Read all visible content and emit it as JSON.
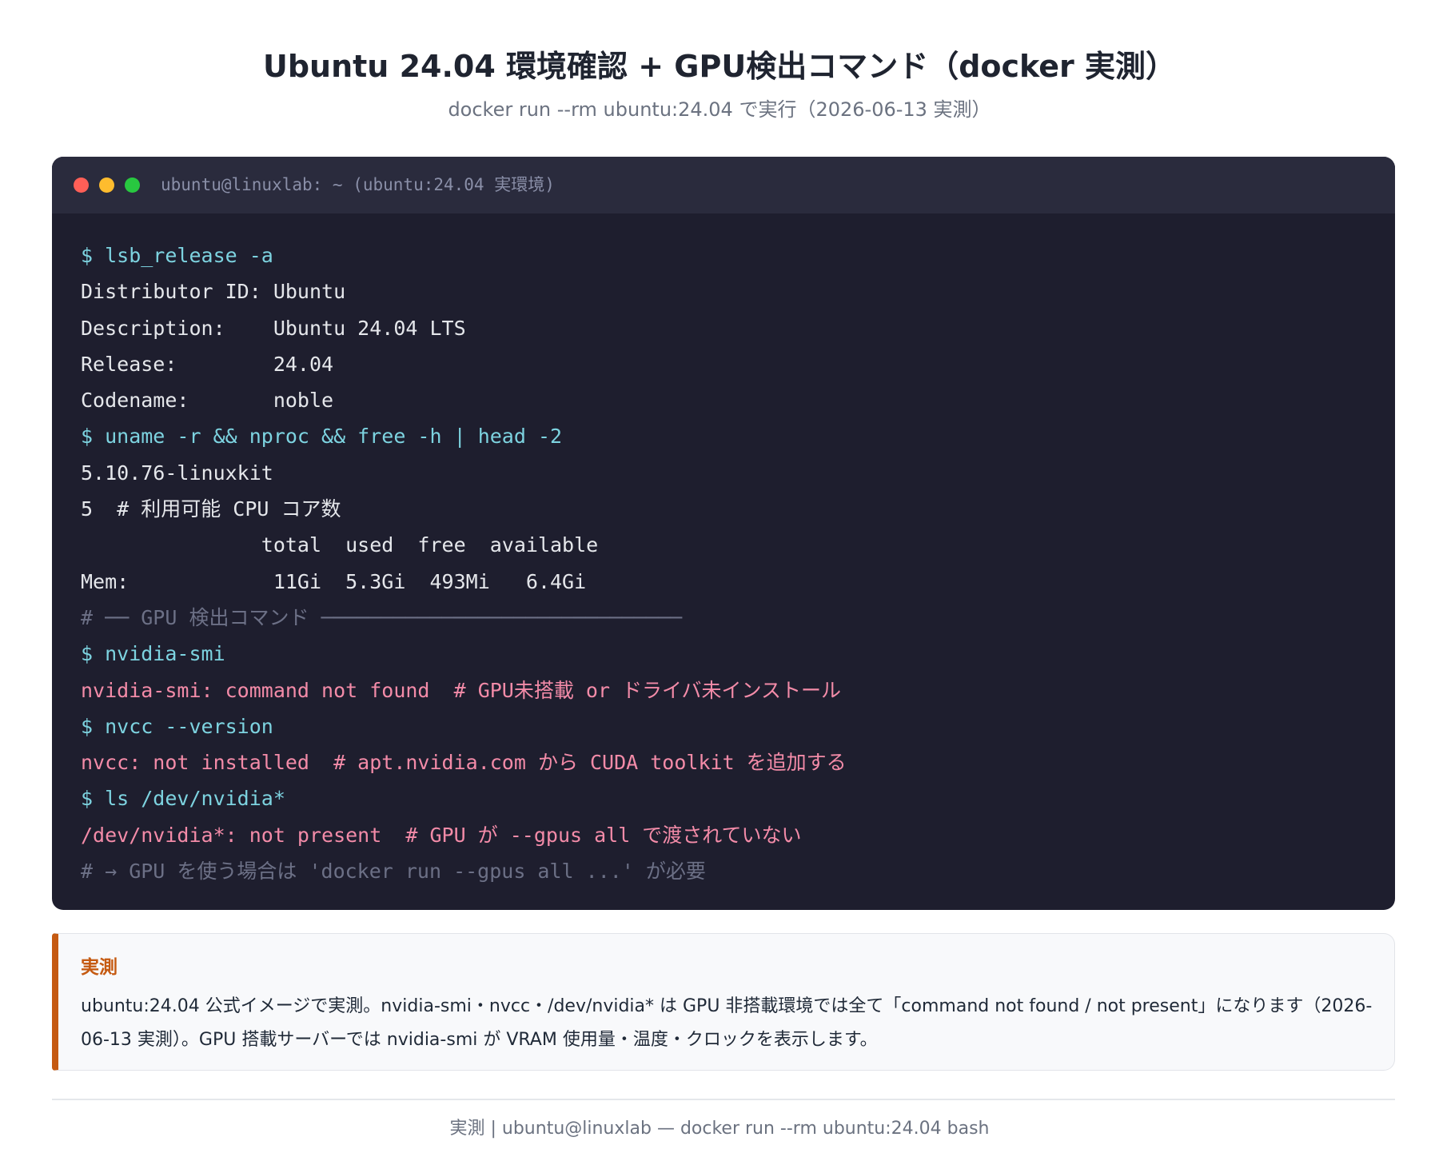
{
  "header": {
    "title": "Ubuntu 24.04 環境確認 + GPU検出コマンド（docker 実測）",
    "subtitle": "docker run --rm ubuntu:24.04 で実行（2026-06-13 実測）"
  },
  "terminal": {
    "window_title": "ubuntu@linuxlab: ~ (ubuntu:24.04 実環境)",
    "lines": [
      {
        "type": "cmd",
        "text": "$ lsb_release -a"
      },
      {
        "type": "out",
        "text": "Distributor ID: Ubuntu"
      },
      {
        "type": "out",
        "text": "Description:    Ubuntu 24.04 LTS"
      },
      {
        "type": "out",
        "text": "Release:        24.04"
      },
      {
        "type": "out",
        "text": "Codename:       noble"
      },
      {
        "type": "cmd",
        "text": "$ uname -r && nproc && free -h | head -2"
      },
      {
        "type": "out",
        "text": "5.10.76-linuxkit"
      },
      {
        "type": "out",
        "text": "5  # 利用可能 CPU コア数"
      },
      {
        "type": "out",
        "text": "               total  used  free  available"
      },
      {
        "type": "out",
        "text": "Mem:            11Gi  5.3Gi  493Mi   6.4Gi"
      },
      {
        "type": "cmt",
        "text": "# ── GPU 検出コマンド ──────────────────────────────"
      },
      {
        "type": "cmd",
        "text": "$ nvidia-smi"
      },
      {
        "type": "err",
        "text": "nvidia-smi: command not found  # GPU未搭載 or ドライバ未インストール"
      },
      {
        "type": "cmd",
        "text": "$ nvcc --version"
      },
      {
        "type": "err",
        "text": "nvcc: not installed  # apt.nvidia.com から CUDA toolkit を追加する"
      },
      {
        "type": "cmd",
        "text": "$ ls /dev/nvidia*"
      },
      {
        "type": "err",
        "text": "/dev/nvidia*: not present  # GPU が --gpus all で渡されていない"
      },
      {
        "type": "cmt",
        "text": "# → GPU を使う場合は 'docker run --gpus all ...' が必要"
      }
    ]
  },
  "note": {
    "heading": "実測",
    "text": "ubuntu:24.04 公式イメージで実測。nvidia-smi・nvcc・/dev/nvidia* は GPU 非搭載環境では全て「command not found / not present」になります（2026-06-13 実測）。GPU 搭載サーバーでは nvidia-smi が VRAM 使用量・温度・クロックを表示します。"
  },
  "footer": {
    "text": "実測 | ubuntu@linuxlab — docker run --rm ubuntu:24.04 bash"
  },
  "colors": {
    "terminal_bg": "#1e1e2e",
    "terminal_bar": "#2a2b3d",
    "command": "#7dd3e0",
    "output": "#e5e7eb",
    "error": "#f38ba8",
    "comment": "#6c7086",
    "note_accent": "#c55a11"
  }
}
